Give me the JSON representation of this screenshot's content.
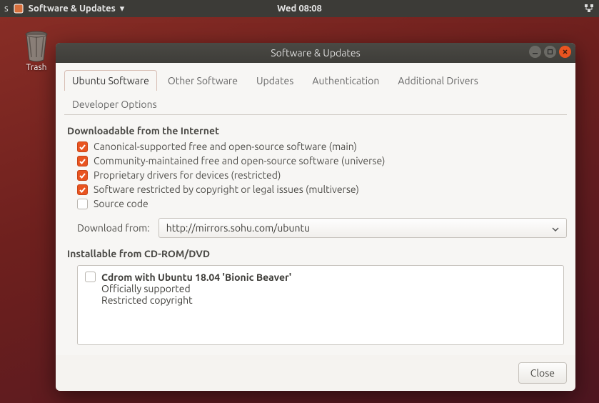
{
  "topbar": {
    "app_title": "Software & Updates",
    "menu_arrow": "▾",
    "clock": "Wed 08:08"
  },
  "desktop": {
    "trash_label": "Trash"
  },
  "window": {
    "title": "Software & Updates",
    "tabs": [
      {
        "label": "Ubuntu Software",
        "active": true
      },
      {
        "label": "Other Software",
        "active": false
      },
      {
        "label": "Updates",
        "active": false
      },
      {
        "label": "Authentication",
        "active": false
      },
      {
        "label": "Additional Drivers",
        "active": false
      },
      {
        "label": "Developer Options",
        "active": false
      }
    ],
    "section1_title": "Downloadable from the Internet",
    "checks": [
      {
        "label": "Canonical-supported free and open-source software (main)",
        "checked": true
      },
      {
        "label": "Community-maintained free and open-source software (universe)",
        "checked": true
      },
      {
        "label": "Proprietary drivers for devices (restricted)",
        "checked": true
      },
      {
        "label": "Software restricted by copyright or legal issues (multiverse)",
        "checked": true
      },
      {
        "label": "Source code",
        "checked": false
      }
    ],
    "download_label": "Download from:",
    "download_value": "http://mirrors.sohu.com/ubuntu",
    "section2_title": "Installable from CD-ROM/DVD",
    "cdrom": {
      "checked": false,
      "title": "Cdrom with Ubuntu 18.04 'Bionic Beaver'",
      "line2": "Officially supported",
      "line3": "Restricted copyright"
    },
    "close_label": "Close"
  }
}
